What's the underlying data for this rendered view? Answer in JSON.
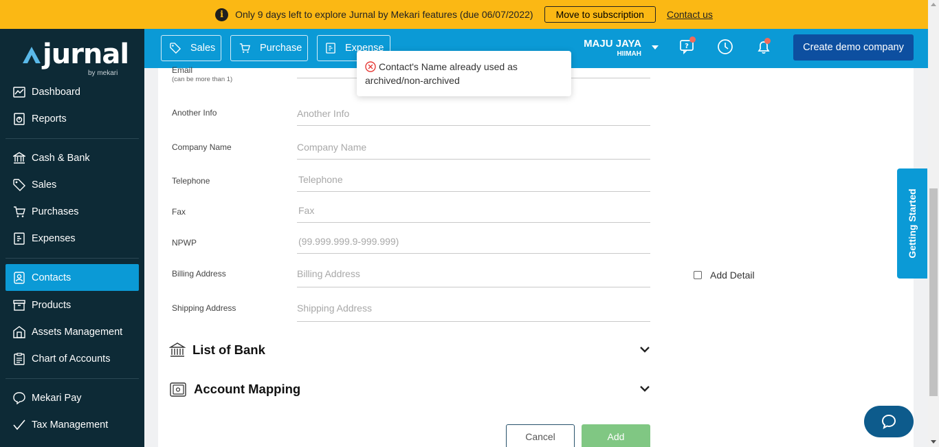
{
  "banner": {
    "message": "Only 9 days left to explore Jurnal by Mekari features (due 06/07/2022)",
    "subscribe_label": "Move to subscription",
    "contact_label": "Contact us"
  },
  "logo": {
    "word": "jurnal",
    "by": "by mekari"
  },
  "sidebar": {
    "items": [
      {
        "label": "Dashboard",
        "icon": "dashboard-icon"
      },
      {
        "label": "Reports",
        "icon": "reports-icon"
      },
      {
        "label": "Cash & Bank",
        "icon": "bank-icon"
      },
      {
        "label": "Sales",
        "icon": "tag-icon"
      },
      {
        "label": "Purchases",
        "icon": "cart-icon"
      },
      {
        "label": "Expenses",
        "icon": "receipt-icon"
      },
      {
        "label": "Contacts",
        "icon": "contact-icon",
        "active": true
      },
      {
        "label": "Products",
        "icon": "box-icon"
      },
      {
        "label": "Assets Management",
        "icon": "building-icon"
      },
      {
        "label": "Chart of Accounts",
        "icon": "clipboard-icon"
      },
      {
        "label": "Mekari Pay",
        "icon": "pay-icon"
      },
      {
        "label": "Tax Management",
        "icon": "checkmark-icon"
      }
    ]
  },
  "topbar": {
    "sales_label": "Sales",
    "purchase_label": "Purchase",
    "expense_label": "Expense",
    "company_name": "MAJU JAYA",
    "company_user": "HIIMAH",
    "demo_label": "Create demo company"
  },
  "toast": {
    "message": "Contact's Name already used as archived/non-archived"
  },
  "form": {
    "email_label": "Email",
    "email_hint": "(can be more than 1)",
    "fields": [
      {
        "label": "Another Info",
        "placeholder": "Another Info"
      },
      {
        "label": "Company Name",
        "placeholder": "Company Name"
      },
      {
        "label": "Telephone",
        "placeholder": "Telephone"
      },
      {
        "label": "Fax",
        "placeholder": "Fax"
      },
      {
        "label": "NPWP",
        "placeholder": "(99.999.999.9-999.999)"
      },
      {
        "label": "Billing Address",
        "placeholder": "Billing Address"
      },
      {
        "label": "Shipping Address",
        "placeholder": "Shipping Address"
      }
    ],
    "add_detail_label": "Add Detail",
    "list_of_bank_title": "List of Bank",
    "account_mapping_title": "Account Mapping",
    "cancel_label": "Cancel",
    "add_label": "Add"
  },
  "getting_started_label": "Getting Started",
  "colors": {
    "banner": "#fbb814",
    "sidebar": "#0d2a36",
    "primary": "#0b9ad6",
    "demo_button": "#0d4fa0",
    "add_button": "#80c783"
  }
}
